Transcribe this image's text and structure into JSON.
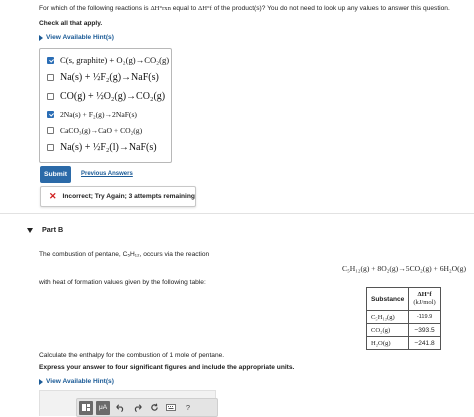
{
  "part_a": {
    "question_prefix": "For which of the following reactions is",
    "dh_rxn_symbol": "ΔH°rxn",
    "question_middle": "equal to",
    "dh_f_symbol": "ΔH°f",
    "question_suffix": "of the product(s)? You do not need to look up any values to answer this question.",
    "instruction": "Check all that apply.",
    "hint_label": "View Available Hint(s)",
    "choices": [
      {
        "label": "C(s, graphite) + O₂(g)→CO₂(g)",
        "checked": true
      },
      {
        "label": "Na(s) + ½F₂(g)→NaF(s)",
        "checked": false
      },
      {
        "label": "CO(g) + ½O₂(g)→CO₂(g)",
        "checked": false
      },
      {
        "label": "2Na(s) + F₂(g)→2NaF(s)",
        "checked": true
      },
      {
        "label": "CaCO₃(g)→CaO + CO₂(g)",
        "checked": false
      },
      {
        "label": "Na(s) + ½F₂(l)→NaF(s)",
        "checked": false
      }
    ],
    "submit_label": "Submit",
    "previous_answers_label": "Previous Answers",
    "feedback_text": "Incorrect; Try Again; 3 attempts remaining"
  },
  "part_b": {
    "title": "Part B",
    "intro": "The combustion of pentane, C₅H₁₂, occurs via the reaction",
    "equation": "C₅H₁₂(g) + 8O₂(g)→5CO₂(g) + 6H₂O(g)",
    "table_intro": "with heat of formation values given by the following table:",
    "table": {
      "header_substance": "Substance",
      "header_dhf": "ΔH°f",
      "header_units": "(kJ/mol)",
      "rows": [
        {
          "substance": "C₅H₁₂(g)",
          "value": "-119.9"
        },
        {
          "substance": "CO₂(g)",
          "value": "−393.5"
        },
        {
          "substance": "H₂O(g)",
          "value": "−241.8"
        }
      ]
    },
    "question": "Calculate the enthalpy for the combustion of 1 mole of pentane.",
    "instruction": "Express your answer to four significant figures and include the appropriate units.",
    "hint_label": "View Available Hint(s)",
    "toolbar": {
      "mu_label": "μA",
      "help_label": "?"
    }
  }
}
